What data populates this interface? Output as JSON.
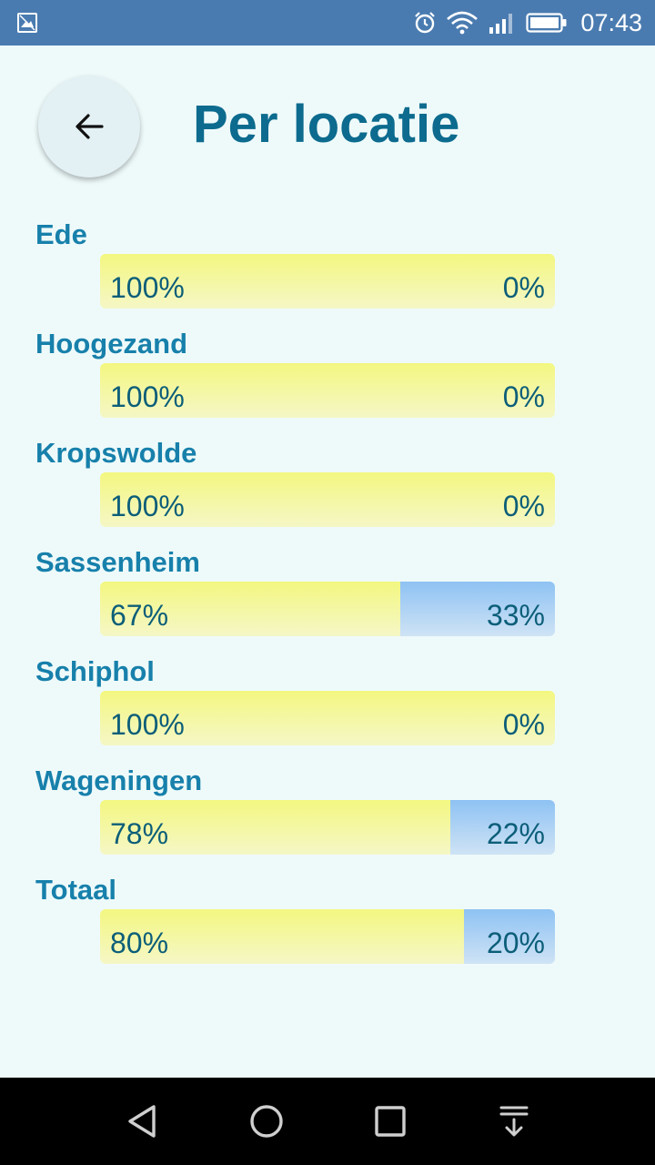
{
  "status_bar": {
    "time": "07:43",
    "icons": [
      "image-icon",
      "alarm-icon",
      "wifi-icon",
      "signal-icon",
      "battery-icon"
    ]
  },
  "header": {
    "title": "Per locatie",
    "back_icon": "arrow-left-icon"
  },
  "locations": [
    {
      "name": "Ede",
      "left_label": "100%",
      "right_label": "0%",
      "fraction": 1.0
    },
    {
      "name": "Hoogezand",
      "left_label": "100%",
      "right_label": "0%",
      "fraction": 1.0
    },
    {
      "name": "Kropswolde",
      "left_label": "100%",
      "right_label": "0%",
      "fraction": 1.0
    },
    {
      "name": "Sassenheim",
      "left_label": "67%",
      "right_label": "33%",
      "fraction": 0.66
    },
    {
      "name": "Schiphol",
      "left_label": "100%",
      "right_label": "0%",
      "fraction": 1.0
    },
    {
      "name": "Wageningen",
      "left_label": "78%",
      "right_label": "22%",
      "fraction": 0.77
    },
    {
      "name": "Totaal",
      "left_label": "80%",
      "right_label": "20%",
      "fraction": 0.8
    }
  ],
  "colors": {
    "title": "#0c6b8e",
    "location_name": "#1780ab",
    "bar_yes": "#f3f780",
    "bar_no": "#8ec2f3",
    "status_bar": "#4a7bb0",
    "background": "#eefafa"
  },
  "nav_bar": {
    "icons": [
      "back-triangle-icon",
      "home-circle-icon",
      "recents-square-icon",
      "notification-pull-icon"
    ]
  }
}
